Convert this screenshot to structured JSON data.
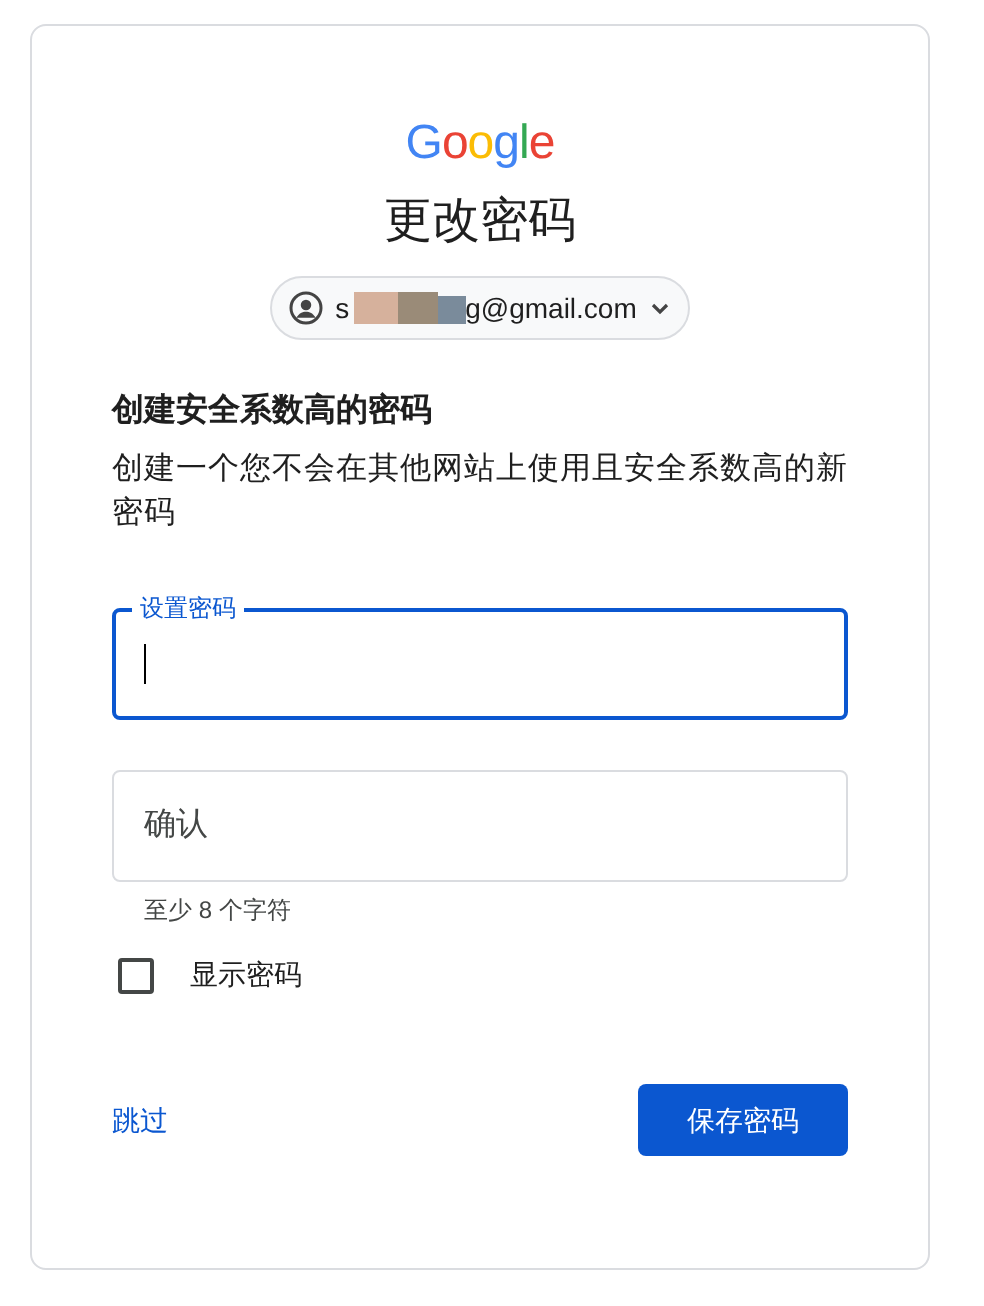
{
  "logo": "Google",
  "title": "更改密码",
  "account": {
    "email_start": "s",
    "email_end": "g@gmail.com"
  },
  "heading": "创建安全系数高的密码",
  "description": "创建一个您不会在其他网站上使用且安全系数高的新密码",
  "fields": [
    {
      "label": "设置密码",
      "focused": true
    },
    {
      "label": "确认",
      "focused": false
    }
  ],
  "hint": "至少 8 个字符",
  "show_password": {
    "label": "显示密码",
    "checked": false
  },
  "skip": "跳过",
  "save": "保存密码"
}
